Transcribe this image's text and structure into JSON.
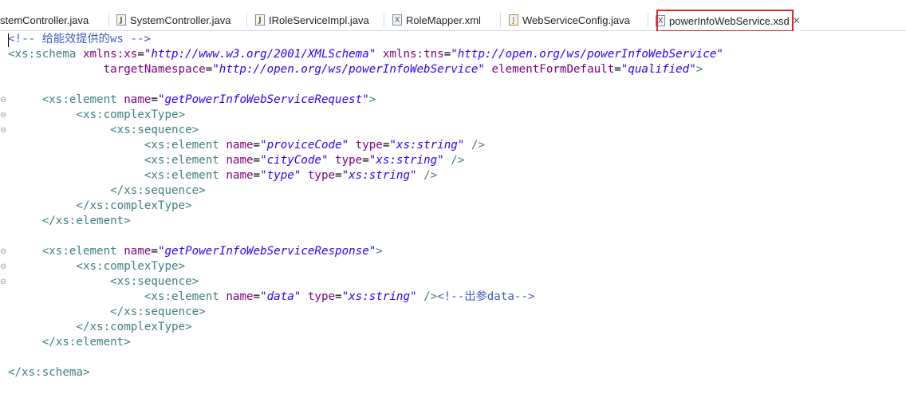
{
  "tabs": [
    {
      "label": "stemController.java",
      "icon": "java-file-icon",
      "active": false
    },
    {
      "label": "SystemController.java",
      "icon": "java-file-icon",
      "active": false
    },
    {
      "label": "IRoleServiceImpl.java",
      "icon": "java-file-icon",
      "active": false
    },
    {
      "label": "RoleMapper.xml",
      "icon": "xml-file-icon",
      "active": false
    },
    {
      "label": "WebServiceConfig.java",
      "icon": "java-class-icon",
      "active": false
    },
    {
      "label": "powerInfoWebService.xsd",
      "icon": "xsd-file-icon",
      "active": true
    }
  ],
  "colors": {
    "tag": "#3f7f7f",
    "attribute": "#7f007f",
    "value": "#2a00ff",
    "comment": "#3f5fbf",
    "highlight_border": "#e0262b"
  },
  "code": {
    "l1_comment": "<!-- 给能效提供的ws -->",
    "l2_open": "<xs:schema",
    "l2_a1": "xmlns:xs",
    "l2_v1": "\"http://www.w3.org/2001/XMLSchema\"",
    "l2_a2": "xmlns:tns",
    "l2_v2": "\"http://open.org/ws/powerInfoWebService\"",
    "l3_a1": "targetNamespace",
    "l3_v1": "\"http://open.org/ws/powerInfoWebService\"",
    "l3_a2": "elementFormDefault",
    "l3_v2": "\"qualified\"",
    "l3_close": ">",
    "el_open": "<xs:element",
    "attr_name": "name",
    "attr_type": "type",
    "req_name": "\"getPowerInfoWebServiceRequest\"",
    "resp_name": "\"getPowerInfoWebServiceResponse\"",
    "complex_open": "<xs:complexType>",
    "complex_close": "</xs:complexType>",
    "seq_open": "<xs:sequence>",
    "seq_close": "</xs:sequence>",
    "el_close": "</xs:element>",
    "f1_name": "\"proviceCode\"",
    "f2_name": "\"cityCode\"",
    "f3_name": "\"type\"",
    "f4_name": "\"data\"",
    "str_type": "\"xs:string\"",
    "selfclose": "/>",
    "gt": ">",
    "eq": "=",
    "f4_comment": "<!--出参data-->",
    "schema_close": "</xs:schema>"
  }
}
